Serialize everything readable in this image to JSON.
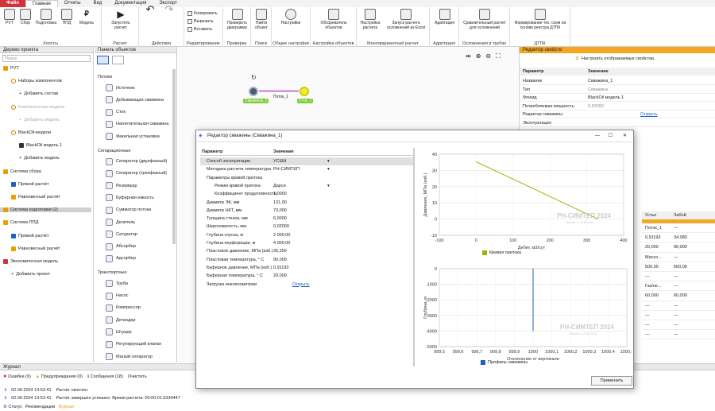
{
  "menu": [
    "Файл",
    "Главная",
    "Отчеты",
    "Вид",
    "Документация",
    "Экспорт"
  ],
  "ribbon": {
    "holst": {
      "label": "Холсты",
      "btns": [
        "PVT",
        "Сбор",
        "Подготовка",
        "ППД",
        "Модель"
      ]
    },
    "raschet": {
      "label": "Расчет",
      "btns": [
        "Запустить расчет"
      ]
    },
    "actions": {
      "label": "Действия"
    },
    "edit": {
      "label": "Редактирование",
      "items": [
        "Копировать",
        "Вырезать",
        "Вставить"
      ]
    },
    "check": {
      "label": "Проверка",
      "btns": [
        "Проверить диаграмму"
      ]
    },
    "search": {
      "label": "Поиск",
      "btns": [
        "Найти объект"
      ]
    },
    "common": {
      "label": "Общие настройки",
      "btns": [
        "Настройки"
      ]
    },
    "objset": {
      "label": "Настройка объектов",
      "btns": [
        "Обозреватель объектов"
      ]
    },
    "multi": {
      "label": "Многовариантный расчет",
      "btns": [
        "Настройка расчета",
        "Запуск расчета осложнений из Excel"
      ]
    },
    "adapt": {
      "label": "Адаптация",
      "btns": [
        "Адаптация"
      ]
    },
    "compl": {
      "label": "Осложнения в трубах",
      "btns": [
        "Сравнительный расчет для осложнений"
      ]
    },
    "dtpk": {
      "label": "ДТПК",
      "btns": [
        "Формирование тех. схем на основе реестра ДТПК"
      ]
    }
  },
  "tree": {
    "title": "Дерево проекта",
    "search": "Поиск",
    "items": [
      "PVT",
      "Наборы компонентов",
      "Добавить состав",
      "Компонентные модели",
      "Добавить модель",
      "BlackOil-модели",
      "BlackOil модель 1",
      "Добавить модель",
      "Система сбора",
      "Прямой расчёт",
      "Равновесный расчёт",
      "Система подготовки (2)",
      "Система ППД",
      "Прямой расчёт",
      "Равновесный расчёт",
      "Экономическая модель",
      "Добавить проект"
    ]
  },
  "objects": {
    "title": "Панель объектов",
    "sections": [
      "Потоки",
      "Сепарационные",
      "Транспортные"
    ],
    "flows": [
      "Источник",
      "Добывающая скважина",
      "Сток",
      "Нагнетательная скважина",
      "Факельная установка"
    ],
    "separ": [
      "Сепаратор (двухфазный)",
      "Сепаратор (трехфазный)",
      "Резервуар",
      "Буферная емкость",
      "Сумматор потока",
      "Делитель",
      "Сатуратор",
      "Абсорбер",
      "Адсорбер"
    ],
    "trans": [
      "Труба",
      "Насос",
      "Компрессор",
      "Детандер",
      "Штуцер",
      "Регулирующий клапан",
      "Малый сепаратор"
    ]
  },
  "diagram": {
    "well": "Скважина_1",
    "flow": "Поток_1",
    "sink": "Сток_1"
  },
  "props": {
    "title": "Редактор свойств",
    "configure": "Настроить отображаемые свойства",
    "hdr": [
      "Параметр",
      "Значение"
    ],
    "rows": [
      [
        "Название",
        "Скважина_1"
      ],
      [
        "Тип",
        "Скважина"
      ],
      [
        "Флюид",
        "BlackOil модель 1"
      ],
      [
        "Потребляемая мощность",
        "0,52092"
      ],
      [
        "Редактор скважины",
        "Открыть"
      ],
      [
        "Эксплуатация",
        ""
      ]
    ]
  },
  "rtable": {
    "hdr": [
      "Устье",
      "Забой"
    ],
    "rows": [
      [
        "Поток_1",
        "—"
      ],
      [
        "0,91193",
        "34,080"
      ],
      [
        "20,000",
        "90,000"
      ],
      [
        "Массо...",
        "—"
      ],
      [
        "500,00",
        "500,00"
      ],
      [
        "—",
        "—"
      ],
      [
        "Газ/не...",
        "—"
      ],
      [
        "60,000",
        "60,000"
      ],
      [
        "—",
        "—"
      ],
      [
        "—",
        "—"
      ],
      [
        "—",
        "—"
      ],
      [
        "—",
        "—"
      ]
    ]
  },
  "journal": {
    "title": "Журнал",
    "errors": "Ошибки (0)",
    "warnings": "Предупреждения (0)",
    "messages": "Сообщения (18)",
    "clear": "Очистить",
    "log": [
      [
        "02.09.2024 13:52:41",
        "Расчет окончен."
      ],
      [
        "02.09.2024 13:52:41",
        "Расчет завершен успешно. Время расчета: 00:00:01.6334447"
      ]
    ],
    "status": [
      "Статус",
      "Рекомендации",
      "Журнал"
    ]
  },
  "dialog": {
    "title": "Редактор скважины (Скважина_1)",
    "hdr": [
      "Параметр",
      "Значение"
    ],
    "rows": [
      [
        "Способ эксплуатации",
        "УСШН"
      ],
      [
        "Методика расчета температуры",
        "РН-СИМТЕП"
      ],
      [
        "Параметры кривой притока",
        ""
      ],
      [
        "Режим кривой притока",
        "Дарси"
      ],
      [
        "Коэффициент продуктивности",
        "1,0000"
      ],
      [
        "Диаметр ЭК, мм",
        "131,00"
      ],
      [
        "Диаметр НКТ, мм",
        "73,000"
      ],
      [
        "Толщина стенок, мм",
        "6,0000"
      ],
      [
        "Шероховатость, мм",
        "0,02000"
      ],
      [
        "Глубина спуска, м",
        "2 000,00"
      ],
      [
        "Глубина перфорации, м",
        "4 000,00"
      ],
      [
        "Пластовое давление, МПа (изб.)",
        "35,359"
      ],
      [
        "Пластовая температура, ° С",
        "90,000"
      ],
      [
        "Буферное давление, МПа (изб.)",
        "0,91193"
      ],
      [
        "Буферная температура, ° С",
        "20,000"
      ],
      [
        "Загрузка инклинометрии",
        "Открыть"
      ]
    ],
    "apply": "Применить",
    "watermark": "РН-СИМТЕП 2024",
    "watermark_sub": "Версия от 26.08.2024"
  },
  "chart_data": [
    {
      "type": "line",
      "xlabel": "Дебит, м3/сут",
      "ylabel": "Давление, МПа (изб.)",
      "xlim": [
        -100,
        400
      ],
      "ylim": [
        -10,
        40
      ],
      "xticks": [
        -100,
        0,
        100,
        200,
        300,
        400
      ],
      "yticks": [
        -10,
        0,
        10,
        20,
        30,
        40
      ],
      "series": [
        {
          "name": "Кривая притока",
          "x": [
            0,
            330
          ],
          "y": [
            35.36,
            0
          ]
        }
      ],
      "color": "#9ab800"
    },
    {
      "type": "line",
      "xlabel": "Отклонение от вертикали",
      "ylabel": "Глубина, м",
      "xlim": [
        999.5,
        1000.5
      ],
      "ylim": [
        -5000,
        0
      ],
      "xticks": [
        "999,5",
        "999,6",
        "999,7",
        "999,8",
        "999,9",
        "1000",
        "1000,1",
        "1000,2",
        "1000,3",
        "1000,4",
        "1000,5"
      ],
      "yticks": [
        0,
        -1000,
        -2000,
        -3000,
        -4000,
        -5000
      ],
      "series": [
        {
          "name": "Профиль скважины",
          "x": [
            1000,
            1000
          ],
          "y": [
            0,
            -4000
          ]
        }
      ],
      "color": "#1f5fbf"
    }
  ]
}
